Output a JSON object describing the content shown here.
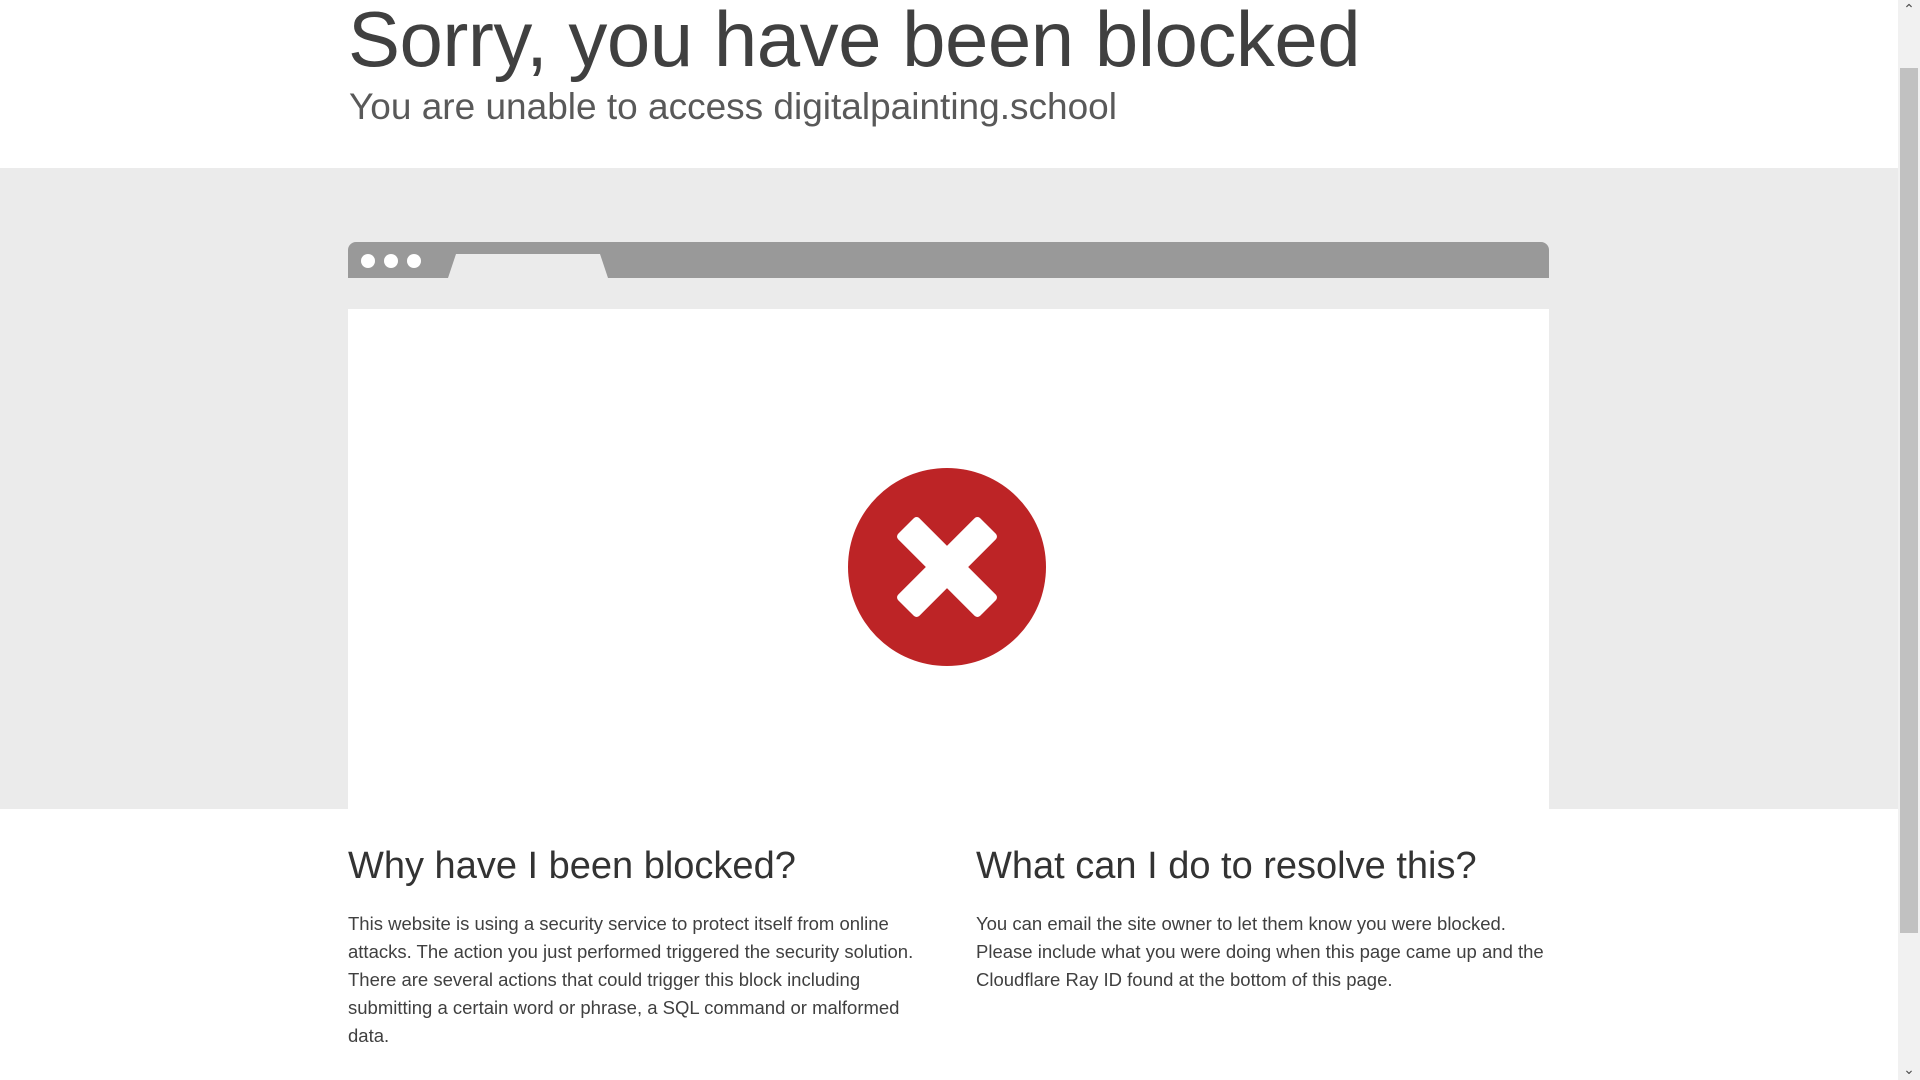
{
  "header": {
    "title": "Sorry, you have been blocked",
    "subtitle": "You are unable to access digitalpainting.school"
  },
  "illustration": {
    "icon": "x-circle-icon",
    "icon_color": "#bd2426"
  },
  "why": {
    "heading": "Why have I been blocked?",
    "body": "This website is using a security service to protect itself from online attacks. The action you just performed triggered the security solution. There are several actions that could trigger this block including submitting a certain word or phrase, a SQL command or malformed data."
  },
  "resolve": {
    "heading": "What can I do to resolve this?",
    "body": "You can email the site owner to let them know you were blocked. Please include what you were doing when this page came up and the Cloudflare Ray ID found at the bottom of this page."
  },
  "scrollbar": {
    "up_icon": "chevron-up-icon",
    "down_icon": "chevron-down-icon"
  }
}
